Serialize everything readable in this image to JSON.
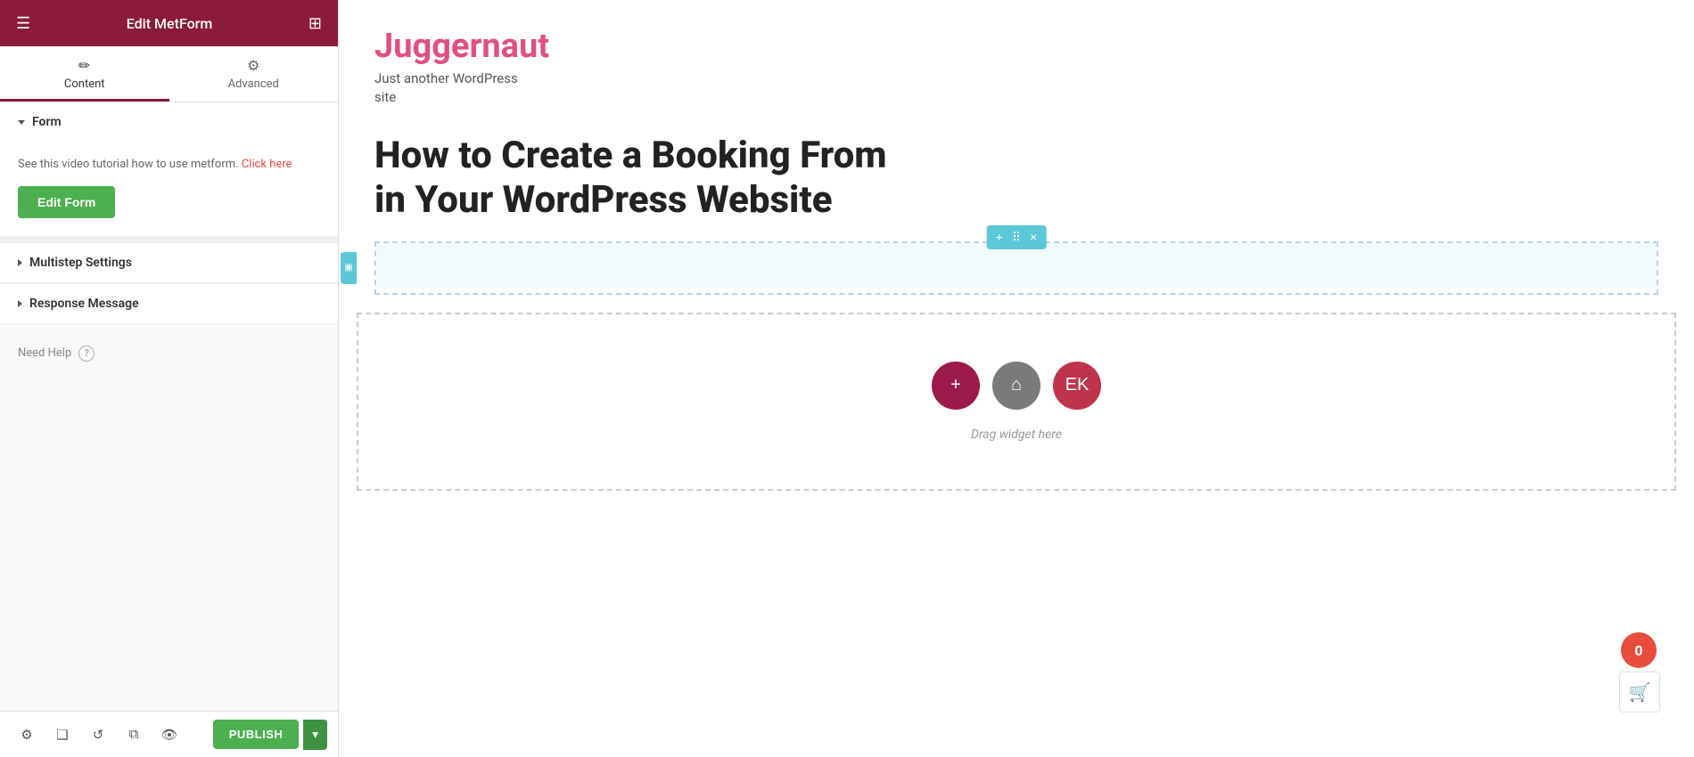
{
  "sidebar": {
    "header": {
      "title": "Edit MetForm",
      "hamburger_icon": "☰",
      "grid_icon": "⊞"
    },
    "tabs": [
      {
        "id": "content",
        "label": "Content",
        "icon": "✏️",
        "active": true
      },
      {
        "id": "advanced",
        "label": "Advanced",
        "icon": "⚙️",
        "active": false
      }
    ],
    "sections": {
      "form": {
        "label": "Form",
        "tutorial_text": "See this video tutorial how to use metform.",
        "click_here_label": "Click here",
        "edit_form_button": "Edit Form"
      },
      "multistep": {
        "label": "Multistep Settings"
      },
      "response": {
        "label": "Response Message"
      }
    },
    "need_help": "Need Help"
  },
  "bottom_bar": {
    "publish_label": "PUBLISH",
    "icons": [
      "⚙",
      "❏",
      "↺",
      "⧉",
      "👁"
    ]
  },
  "main": {
    "site_title": "Juggernaut",
    "site_subtitle_line1": "Just another WordPress",
    "site_subtitle_line2": "site",
    "article_title_line1": "How to Create a Booking From",
    "article_title_line2": "in Your WordPress Website",
    "drag_widget_text": "Drag widget here"
  },
  "widget_toolbar": {
    "add_icon": "+",
    "move_icon": "⠿",
    "close_icon": "×"
  },
  "drag_zone_buttons": [
    {
      "id": "add",
      "icon": "+",
      "class": "dz-btn-add"
    },
    {
      "id": "folder",
      "icon": "⌂",
      "class": "dz-btn-folder"
    },
    {
      "id": "ek",
      "icon": "EK",
      "class": "dz-btn-ek"
    }
  ],
  "notification": {
    "count": "0"
  }
}
